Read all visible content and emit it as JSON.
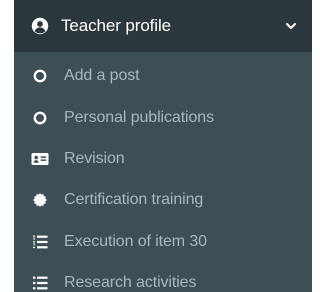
{
  "menu": {
    "header": {
      "label": "Teacher profile",
      "icon": "user-circle-icon",
      "toggle_icon": "chevron-down-icon"
    },
    "items": [
      {
        "label": "Add a post",
        "icon": "circle-outline-icon"
      },
      {
        "label": "Personal publications",
        "icon": "circle-outline-icon"
      },
      {
        "label": "Revision",
        "icon": "id-card-icon"
      },
      {
        "label": "Certification training",
        "icon": "certificate-icon"
      },
      {
        "label": "Execution of item 30",
        "icon": "list-ol-icon"
      },
      {
        "label": "Research activities",
        "icon": "list-ul-icon"
      }
    ]
  },
  "colors": {
    "header_bg": "#2c373d",
    "submenu_bg": "#3d4e55",
    "header_text": "#ffffff",
    "item_text": "#a8b8bf"
  }
}
